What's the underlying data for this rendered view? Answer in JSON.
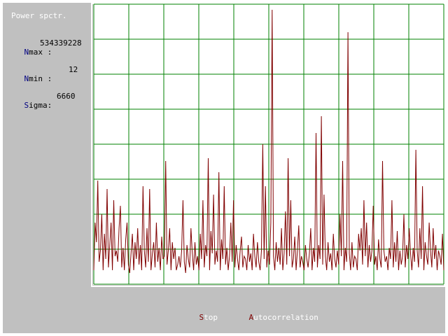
{
  "sidebar": {
    "title": "Power spctr.",
    "stats": [
      {
        "key": "N",
        "rest": "max :",
        "value": "534339228"
      },
      {
        "key": "N",
        "rest": "min :",
        "value": "12"
      },
      {
        "key": "S",
        "rest": "igma:",
        "value": "6660"
      }
    ]
  },
  "menu": [
    {
      "hotkey": "S",
      "rest": "top"
    },
    {
      "hotkey": "A",
      "rest": "utocorrelation"
    }
  ],
  "colors": {
    "panel": "#c0c0c0",
    "grid": "#008000",
    "trace": "#800000",
    "hotkey_stat": "#000080",
    "hotkey_menu": "#800000"
  },
  "chart_data": {
    "type": "line",
    "title": "",
    "xlabel": "",
    "ylabel": "",
    "grid": true,
    "ylim": [
      0,
      1
    ],
    "values": [
      0.05,
      0.22,
      0.15,
      0.37,
      0.08,
      0.12,
      0.25,
      0.05,
      0.18,
      0.09,
      0.34,
      0.06,
      0.14,
      0.22,
      0.05,
      0.3,
      0.1,
      0.12,
      0.08,
      0.2,
      0.28,
      0.06,
      0.13,
      0.05,
      0.16,
      0.22,
      0.07,
      0.04,
      0.11,
      0.18,
      0.05,
      0.15,
      0.09,
      0.2,
      0.07,
      0.14,
      0.05,
      0.35,
      0.12,
      0.06,
      0.2,
      0.08,
      0.34,
      0.05,
      0.11,
      0.15,
      0.06,
      0.22,
      0.08,
      0.13,
      0.05,
      0.17,
      0.09,
      0.1,
      0.44,
      0.07,
      0.12,
      0.2,
      0.05,
      0.15,
      0.09,
      0.13,
      0.05,
      0.07,
      0.1,
      0.06,
      0.12,
      0.3,
      0.08,
      0.04,
      0.14,
      0.09,
      0.06,
      0.2,
      0.11,
      0.05,
      0.15,
      0.07,
      0.1,
      0.05,
      0.18,
      0.09,
      0.3,
      0.06,
      0.14,
      0.1,
      0.45,
      0.05,
      0.19,
      0.11,
      0.32,
      0.07,
      0.12,
      0.08,
      0.4,
      0.05,
      0.16,
      0.09,
      0.35,
      0.07,
      0.13,
      0.05,
      0.1,
      0.22,
      0.08,
      0.3,
      0.06,
      0.14,
      0.09,
      0.05,
      0.12,
      0.17,
      0.06,
      0.1,
      0.09,
      0.05,
      0.14,
      0.08,
      0.11,
      0.05,
      0.18,
      0.1,
      0.06,
      0.15,
      0.08,
      0.05,
      0.12,
      0.5,
      0.09,
      0.35,
      0.06,
      0.12,
      0.07,
      0.22,
      0.98,
      0.1,
      0.05,
      0.15,
      0.08,
      0.13,
      0.07,
      0.2,
      0.05,
      0.11,
      0.26,
      0.07,
      0.45,
      0.1,
      0.3,
      0.06,
      0.09,
      0.17,
      0.05,
      0.12,
      0.21,
      0.06,
      0.1,
      0.08,
      0.05,
      0.14,
      0.09,
      0.06,
      0.11,
      0.2,
      0.05,
      0.13,
      0.08,
      0.54,
      0.06,
      0.14,
      0.09,
      0.6,
      0.07,
      0.32,
      0.1,
      0.05,
      0.15,
      0.08,
      0.11,
      0.05,
      0.18,
      0.09,
      0.06,
      0.12,
      0.07,
      0.25,
      0.1,
      0.44,
      0.05,
      0.13,
      0.08,
      0.9,
      0.11,
      0.05,
      0.15,
      0.06,
      0.1,
      0.09,
      0.05,
      0.18,
      0.12,
      0.2,
      0.07,
      0.3,
      0.1,
      0.22,
      0.06,
      0.14,
      0.08,
      0.12,
      0.28,
      0.07,
      0.1,
      0.05,
      0.16,
      0.09,
      0.06,
      0.44,
      0.12,
      0.08,
      0.1,
      0.05,
      0.13,
      0.09,
      0.3,
      0.06,
      0.15,
      0.08,
      0.19,
      0.05,
      0.12,
      0.07,
      0.1,
      0.25,
      0.06,
      0.14,
      0.09,
      0.2,
      0.11,
      0.05,
      0.13,
      0.08,
      0.48,
      0.12,
      0.06,
      0.2,
      0.09,
      0.35,
      0.05,
      0.15,
      0.1,
      0.07,
      0.22,
      0.12,
      0.06,
      0.2,
      0.09,
      0.14,
      0.05,
      0.12,
      0.1,
      0.07,
      0.18,
      0.05
    ]
  }
}
